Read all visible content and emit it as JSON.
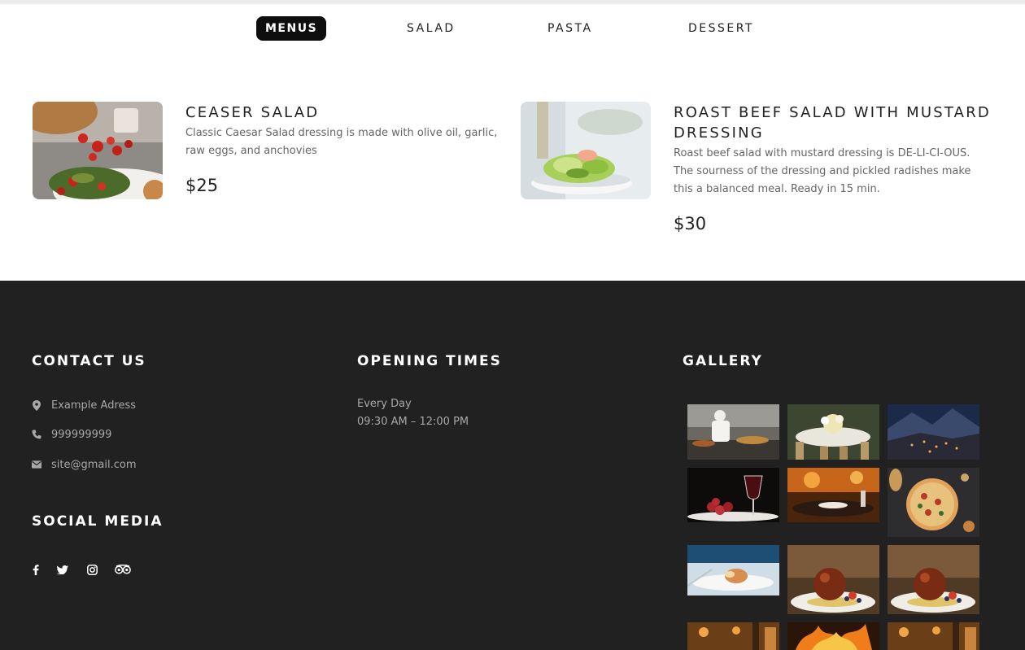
{
  "tabs": [
    {
      "label": "MENUS",
      "active": true
    },
    {
      "label": "SALAD",
      "active": false
    },
    {
      "label": "PASTA",
      "active": false
    },
    {
      "label": "DESSERT",
      "active": false
    }
  ],
  "menu_items": [
    {
      "title": "CEASER SALAD",
      "description": "Classic Caesar Salad dressing is made with olive oil, garlic, raw eggs, and anchovies",
      "price": "$25"
    },
    {
      "title": "ROAST BEEF SALAD WITH MUSTARD DRESSING",
      "description": "Roast beef salad with mustard dressing is DE-LI-CI-OUS. The sourness of the dressing and pickled radishes make this a balanced meal. Ready in 15 min.",
      "price": "$30"
    }
  ],
  "footer": {
    "contact": {
      "heading": "CONTACT US",
      "address": "Example Adress",
      "phone": "999999999",
      "email": "site@gmail.com"
    },
    "opening": {
      "heading": "OPENING TIMES",
      "days": "Every Day",
      "hours": "09:30 AM – 12:00 PM"
    },
    "social": {
      "heading": "SOCIAL MEDIA",
      "icons": [
        "facebook-icon",
        "twitter-icon",
        "instagram-icon",
        "tripadvisor-icon"
      ]
    },
    "gallery": {
      "heading": "GALLERY",
      "images": [
        "chef-kitchen",
        "banquet-table",
        "mountain-village-night",
        "wine-and-grapes",
        "restaurant-candlelight",
        "pizza-table",
        "plated-dish",
        "dessert-plate",
        "dessert-plate",
        "restaurant-interior",
        "grill-fire",
        "restaurant-interior"
      ]
    }
  },
  "colors": {
    "accent": "#0e0e0e",
    "footer_bg": "#222121",
    "heading_text": "#ffffff",
    "muted_text": "#a8a8a8"
  }
}
